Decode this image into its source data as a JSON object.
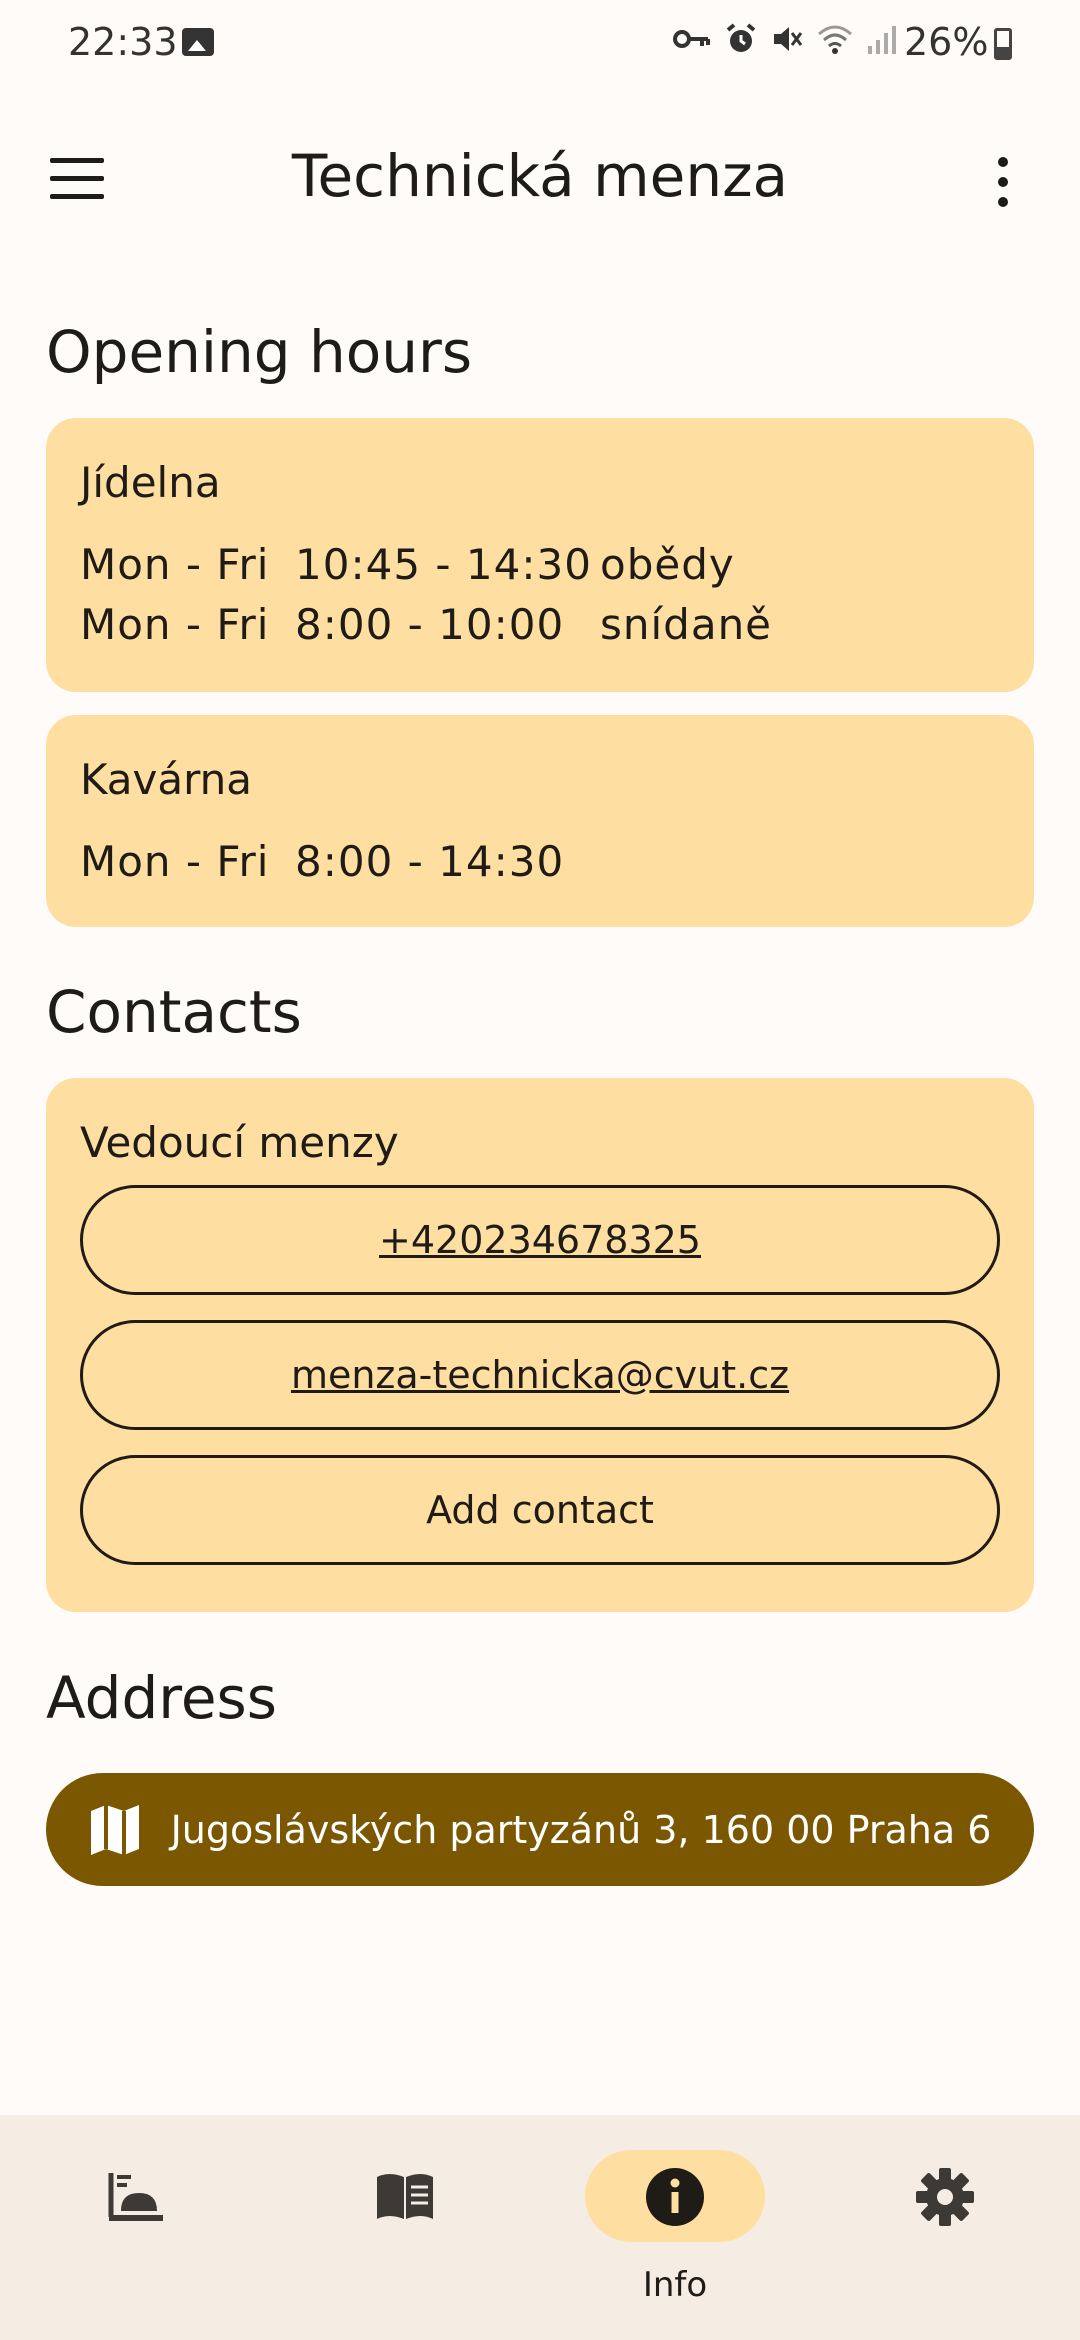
{
  "status_bar": {
    "time": "22:33",
    "battery": "26%"
  },
  "app_bar": {
    "title": "Technická menza"
  },
  "opening_hours": {
    "heading": "Opening hours",
    "places": [
      {
        "name": "Jídelna",
        "rows": [
          {
            "days": "Mon - Fri",
            "time": "10:45 - 14:30",
            "note": "obědy"
          },
          {
            "days": "Mon - Fri",
            "time": "8:00 - 10:00",
            "note": "snídaně"
          }
        ]
      },
      {
        "name": "Kavárna",
        "rows": [
          {
            "days": "Mon - Fri",
            "time": "8:00 - 14:30",
            "note": ""
          }
        ]
      }
    ]
  },
  "contacts": {
    "heading": "Contacts",
    "group": "Vedoucí menzy",
    "phone": "+420234678325",
    "email": "menza-technicka@cvut.cz",
    "add_label": "Add contact"
  },
  "address": {
    "heading": "Address",
    "text": "Jugoslávských partyzánů 3, 160 00 Praha 6"
  },
  "bottom_nav": {
    "items": [
      {
        "icon": "canteen-food-icon",
        "label": ""
      },
      {
        "icon": "menu-book-icon",
        "label": ""
      },
      {
        "icon": "info-icon",
        "label": "Info",
        "active": true
      },
      {
        "icon": "gear-icon",
        "label": ""
      }
    ]
  },
  "colors": {
    "card": "#ffdea1",
    "accent": "#7a5700",
    "background": "#fffbf8",
    "nav": "#f5ede3"
  }
}
